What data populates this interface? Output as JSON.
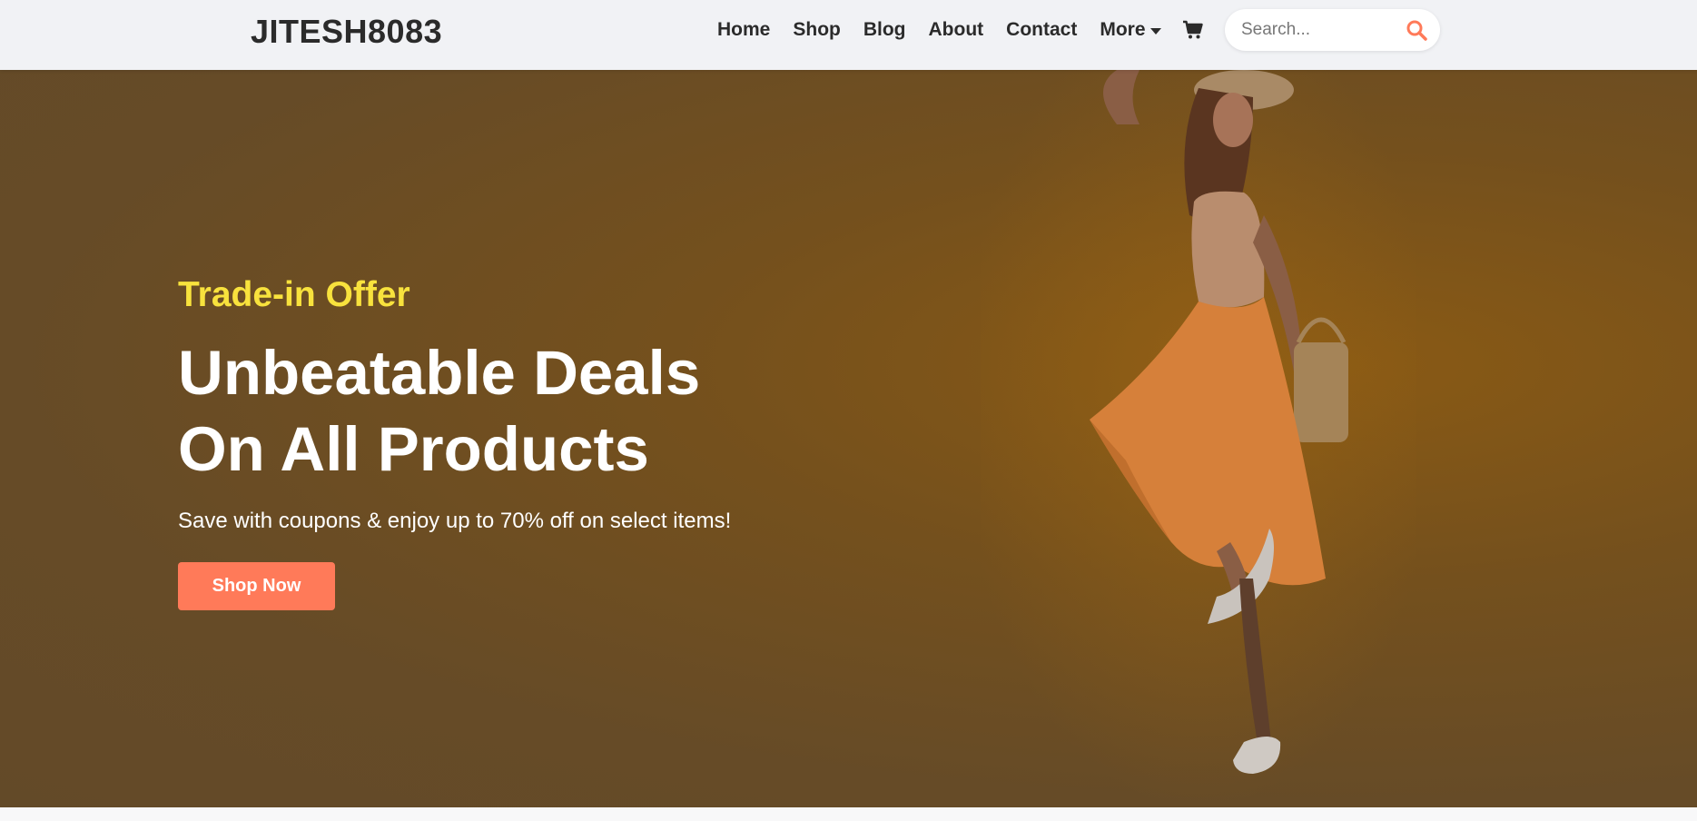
{
  "navbar": {
    "logo": "JITESH8083",
    "links": [
      "Home",
      "Shop",
      "Blog",
      "About",
      "Contact"
    ],
    "more_label": "More",
    "cart_icon": "cart-icon",
    "search": {
      "placeholder": "Search...",
      "icon": "search-icon"
    }
  },
  "hero": {
    "offer": "Trade-in Offer",
    "headline_line1": "Unbeatable Deals",
    "headline_line2": "On All Products",
    "subtext": "Save with coupons & enjoy up to 70% off on select items!",
    "button_label": "Shop Now",
    "image": "woman-in-orange-dress"
  },
  "colors": {
    "accent": "#ff7a59",
    "offer_text": "#f8e23d",
    "hero_bg": "#664b27",
    "navbar_bg": "#f1f2f5"
  }
}
